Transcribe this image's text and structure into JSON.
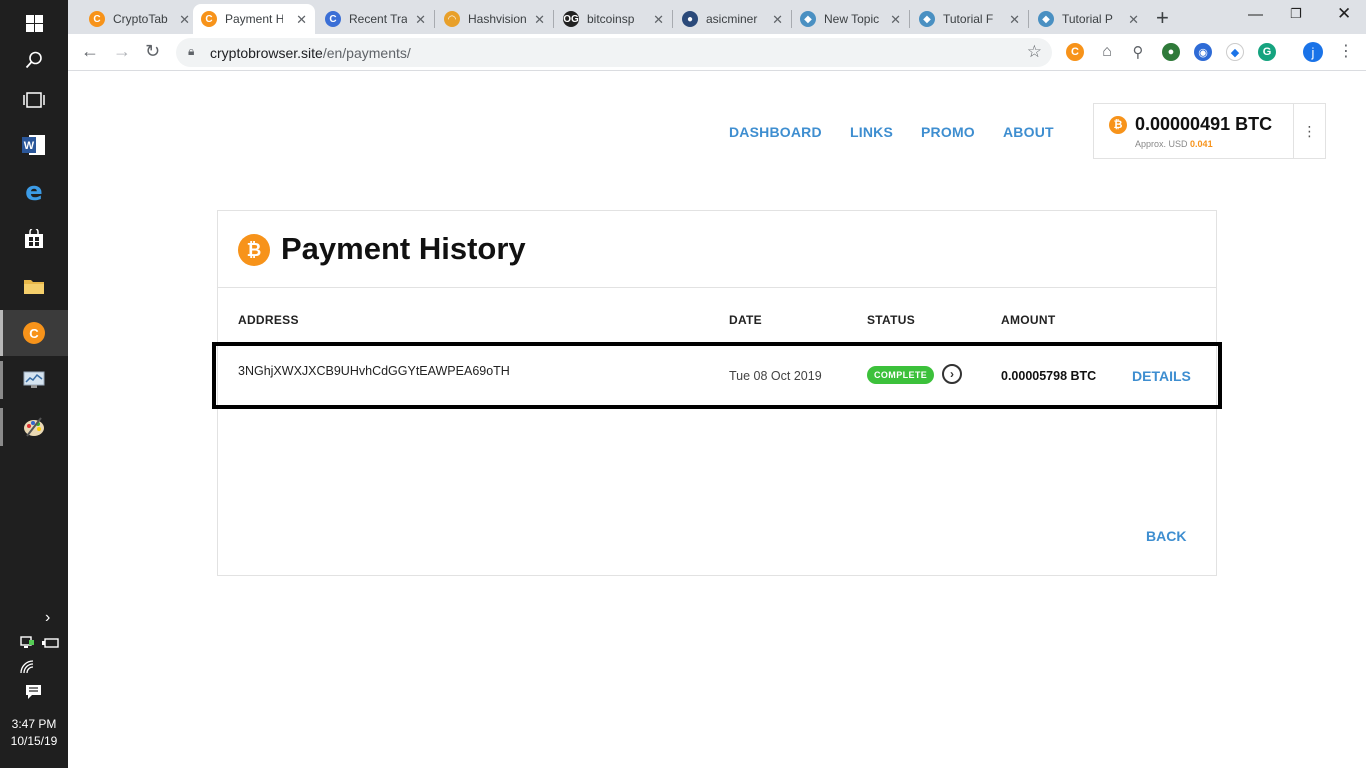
{
  "taskbar": {
    "clock_time": "3:47 PM",
    "clock_date": "10/15/19"
  },
  "tabs": [
    {
      "title": "CryptoTab",
      "favicon": "cryptotab-icon",
      "color": "#f7931a",
      "glyph": "C"
    },
    {
      "title": "Payment H",
      "favicon": "cryptotab-icon",
      "color": "#f7931a",
      "glyph": "C",
      "active": true
    },
    {
      "title": "Recent Tra",
      "favicon": "c-icon",
      "color": "#3b6fd6",
      "glyph": "C"
    },
    {
      "title": "Hashvision",
      "favicon": "gauge-icon",
      "color": "#e8a02a",
      "glyph": "◠"
    },
    {
      "title": "bitcoinsp",
      "favicon": "og-icon",
      "color": "#222222",
      "glyph": "OG"
    },
    {
      "title": "asicminer",
      "favicon": "globe-icon",
      "color": "#2b4a7a",
      "glyph": "●"
    },
    {
      "title": "New Topic",
      "favicon": "cube-icon",
      "color": "#4a90c2",
      "glyph": "◆"
    },
    {
      "title": "Tutorial F",
      "favicon": "cube-icon",
      "color": "#4a90c2",
      "glyph": "◆"
    },
    {
      "title": "Tutorial P",
      "favicon": "cube-icon",
      "color": "#4a90c2",
      "glyph": "◆"
    }
  ],
  "address_bar": {
    "domain": "cryptobrowser.site",
    "path": "/en/payments/"
  },
  "profile_initial": "j",
  "nav": {
    "dashboard": "DASHBOARD",
    "links": "LINKS",
    "promo": "PROMO",
    "about": "ABOUT"
  },
  "balance": {
    "amount": "0.00000491 BTC",
    "approx_label": "Approx. USD",
    "approx_value": "0.041"
  },
  "card": {
    "title": "Payment History",
    "columns": {
      "address": "ADDRESS",
      "date": "DATE",
      "status": "STATUS",
      "amount": "AMOUNT"
    },
    "payment": {
      "address": "3NGhjXWXJXCB9UHvhCdGGYtEAWPEA69oTH",
      "date": "Tue 08 Oct 2019",
      "status": "COMPLETE",
      "amount": "0.00005798 BTC",
      "details_label": "DETAILS"
    },
    "back_label": "BACK"
  },
  "colors": {
    "accent_blue": "#3e8ed0",
    "bitcoin_orange": "#f7931a",
    "status_green": "#3cc13b"
  }
}
